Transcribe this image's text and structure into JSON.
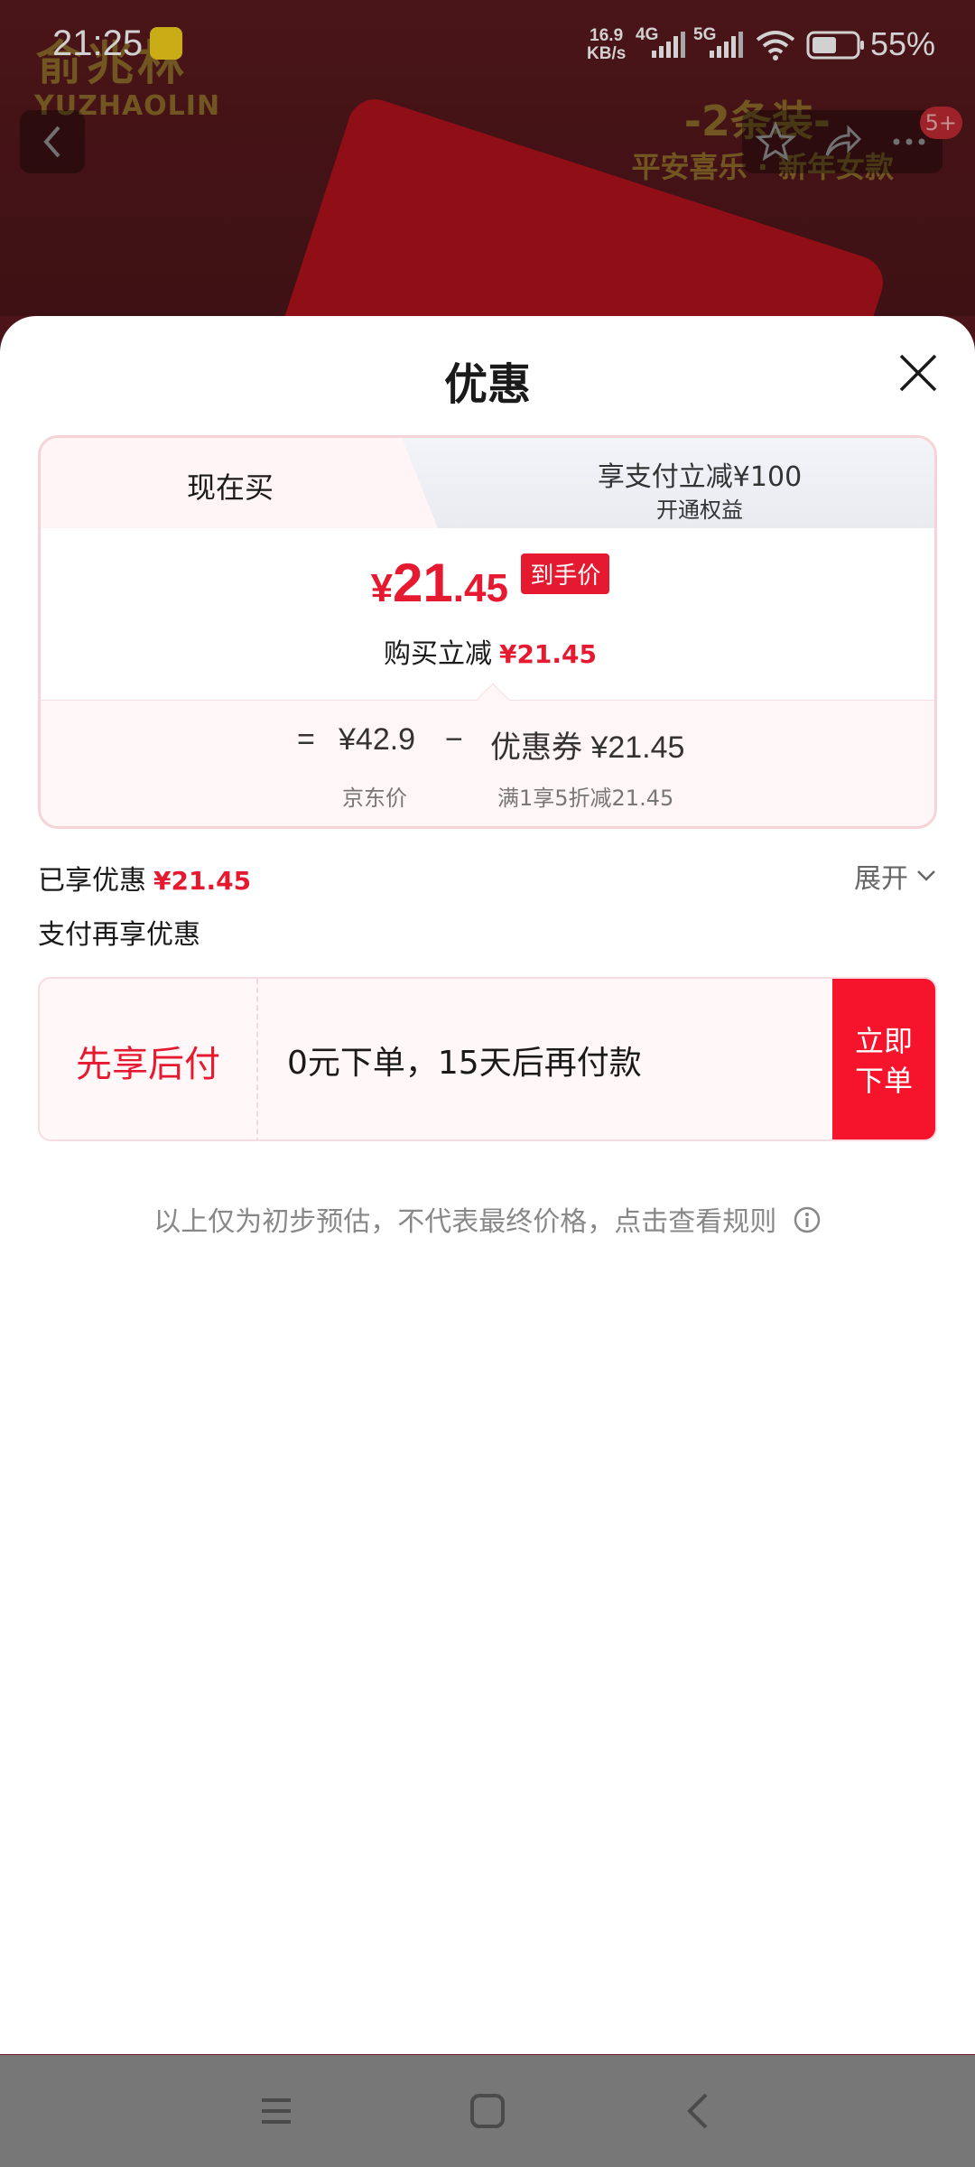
{
  "status_bar": {
    "time": "21:25",
    "speed_value": "16.9",
    "speed_unit": "KB/s",
    "network_1": "4G",
    "network_2": "5G",
    "battery": "55%"
  },
  "background": {
    "brand_cn": "俞兆林",
    "brand_en": "YUZHAOLIN",
    "promo_line1": "-2条装-",
    "promo_line2": "平安喜乐 · 新年女款",
    "notification_badge": "5+"
  },
  "sheet": {
    "title": "优惠",
    "tabs": {
      "active_label": "现在买",
      "right_title": "享支付立减¥100",
      "right_sub": "开通权益"
    },
    "final_price": {
      "yen": "¥",
      "integer": "21",
      "decimal": ".45",
      "tag": "到手价"
    },
    "save": {
      "label": "购买立减",
      "amount": "¥21.45"
    },
    "breakdown": {
      "equals": "=",
      "jd_price": "¥42.9",
      "jd_price_label": "京东价",
      "minus": "−",
      "coupon": "优惠券 ¥21.45",
      "coupon_label": "满1享5折减21.45"
    },
    "enjoyed": {
      "label": "已享优惠",
      "amount": "¥21.45",
      "expand": "展开"
    },
    "pay_more_label": "支付再享优惠",
    "paylater": {
      "label": "先享后付",
      "text": "0元下单，15天后再付款",
      "button": "立即下单"
    },
    "disclaimer": "以上仅为初步预估，不代表最终价格，点击查看规则"
  },
  "colors": {
    "accent": "#e5192f",
    "button": "#f5142c",
    "nav_bar": "#777777"
  }
}
